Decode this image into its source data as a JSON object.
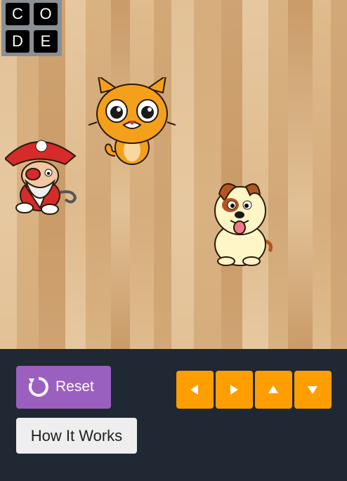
{
  "logo": {
    "letters": [
      "C",
      "O",
      "D",
      "E"
    ]
  },
  "stage": {
    "background": "wood-floor",
    "sprites": [
      "pirate-sprite",
      "cat-sprite",
      "dog-sprite"
    ]
  },
  "controls": {
    "reset_label": "Reset",
    "how_it_works_label": "How It Works",
    "arrow_buttons": [
      "left-arrow-icon",
      "right-arrow-icon",
      "up-arrow-icon",
      "down-arrow-icon"
    ]
  },
  "colors": {
    "reset_button": "#9b5fc0",
    "arrow_button": "#ff9e00",
    "panel": "#1f2833",
    "how_button": "#eeeeee"
  }
}
